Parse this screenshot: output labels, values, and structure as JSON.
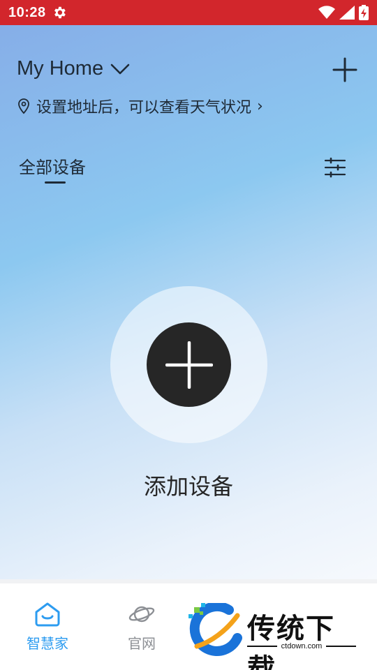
{
  "status_bar": {
    "time": "10:28",
    "icons": [
      "settings-gear-icon",
      "wifi-icon",
      "signal-icon",
      "battery-charging-icon"
    ],
    "color": "#d2262c"
  },
  "header": {
    "home_name": "My Home",
    "location_prompt": "设置地址后，可以查看天气状况",
    "location_chevron": "›"
  },
  "tabs": {
    "active_label": "全部设备"
  },
  "empty_state": {
    "add_label": "添加设备",
    "button_color": "#262626"
  },
  "bottom_nav": {
    "items": [
      {
        "label": "智慧家",
        "icon": "smart-home-icon",
        "active": true
      },
      {
        "label": "官网",
        "icon": "planet-icon",
        "active": false
      }
    ],
    "active_color": "#2d9cf0",
    "inactive_color": "#8c8f94"
  },
  "watermark": {
    "title": "传统下载",
    "url": "ctdown.com"
  }
}
